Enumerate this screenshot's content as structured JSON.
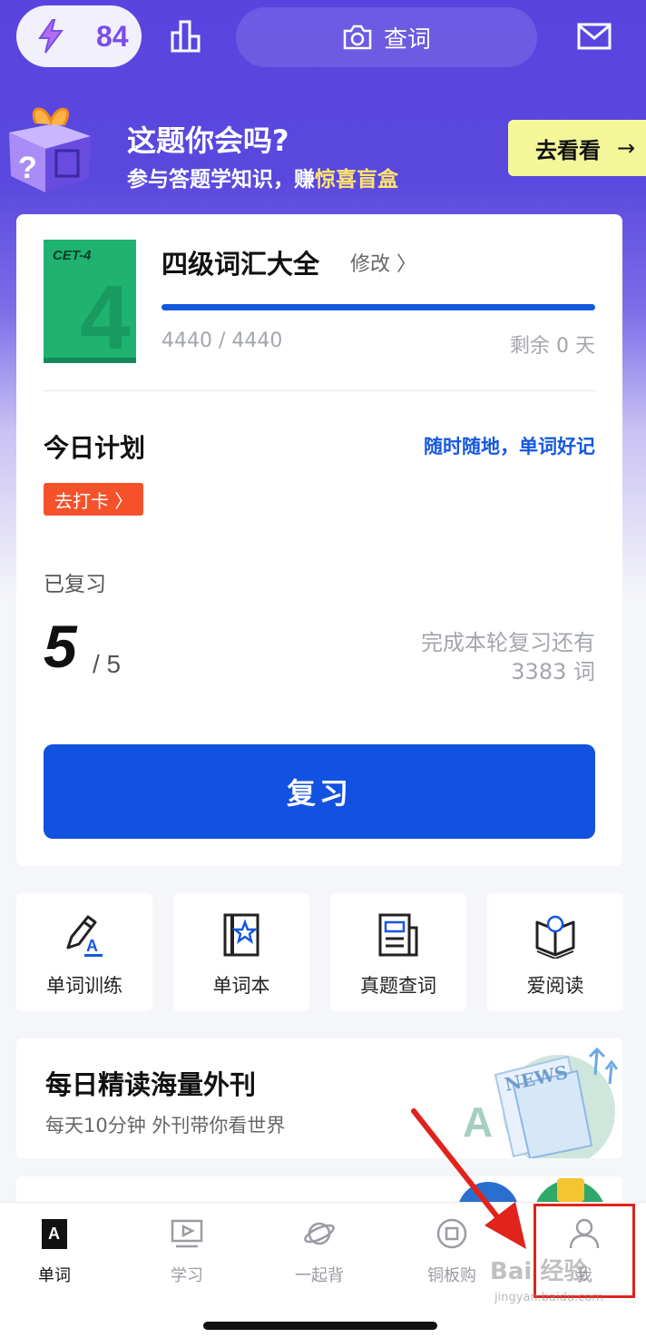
{
  "colors": {
    "brand_purple": "#5a44e0",
    "accent_blue": "#1252e0",
    "checkin_orange": "#f5522c",
    "promo_button": "#f3f79a",
    "highlight_yellow": "#ffe66d",
    "annotation_red": "#e0231c"
  },
  "top_bar": {
    "energy_icon": "lightning-icon",
    "energy_count": "84",
    "rank_icon": "bar-chart-icon",
    "search_icon": "camera-icon",
    "search_label": "查词",
    "mail_icon": "mail-icon"
  },
  "promo": {
    "title": "这题你会吗?",
    "subtitle_prefix": "参与答题学知识，赚",
    "subtitle_highlight": "惊喜盲盒",
    "button_label": "去看看",
    "button_arrow": "→"
  },
  "book": {
    "cover_label": "CET-4",
    "cover_number": "4",
    "title": "四级词汇大全",
    "edit_label": "修改 〉",
    "progress_text": "4440 / 4440",
    "progress_fraction": 1.0,
    "days_left": "剩余 0 天"
  },
  "plan": {
    "title": "今日计划",
    "slogan": "随时随地，单词好记",
    "checkin_label": "去打卡 〉",
    "reviewed_label": "已复习",
    "reviewed_count": "5",
    "reviewed_total": "/ 5",
    "remain_line1": "完成本轮复习还有",
    "remain_line2": "3383 词",
    "review_button": "复习"
  },
  "tiles": [
    {
      "label": "单词训练",
      "icon": "pen-letter-icon"
    },
    {
      "label": "单词本",
      "icon": "star-book-icon"
    },
    {
      "label": "真题查词",
      "icon": "newspaper-icon"
    },
    {
      "label": "爱阅读",
      "icon": "open-book-icon"
    }
  ],
  "news": {
    "title": "每日精读海量外刊",
    "subtitle": "每天10分钟 外刊带你看世界",
    "art_text": "NEWS"
  },
  "tabs": [
    {
      "label": "单词",
      "icon": "word-book-icon",
      "active": true
    },
    {
      "label": "学习",
      "icon": "play-screen-icon",
      "active": false
    },
    {
      "label": "一起背",
      "icon": "planet-icon",
      "active": false
    },
    {
      "label": "铜板购",
      "icon": "coin-icon",
      "active": false
    },
    {
      "label": "我",
      "icon": "person-icon",
      "active": false
    }
  ],
  "watermark": {
    "text": "Bai 经验",
    "url_text": "jingyan.baidu.com"
  }
}
